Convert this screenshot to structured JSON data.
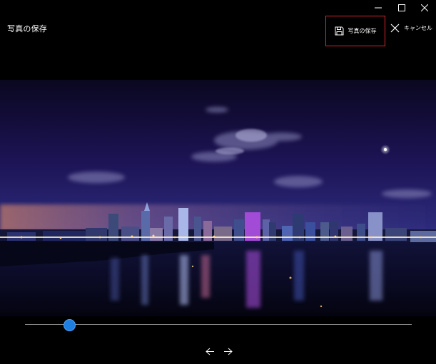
{
  "window": {
    "caption_buttons": [
      "minimize-icon",
      "maximize-icon",
      "close-icon"
    ]
  },
  "header": {
    "title": "写真の保存",
    "save_label": "写真の保存",
    "save_icon": "floppy-disk-icon",
    "save_highlight_color": "#e0242b",
    "cancel_label": "キャンセル",
    "cancel_icon": "close-x-icon"
  },
  "photo": {
    "subject": "night-city-skyline"
  },
  "slider": {
    "value": 0.115,
    "accent_color": "#1e7fe0"
  },
  "navigation": {
    "prev_icon": "arrow-left-icon",
    "next_icon": "arrow-right-icon"
  }
}
